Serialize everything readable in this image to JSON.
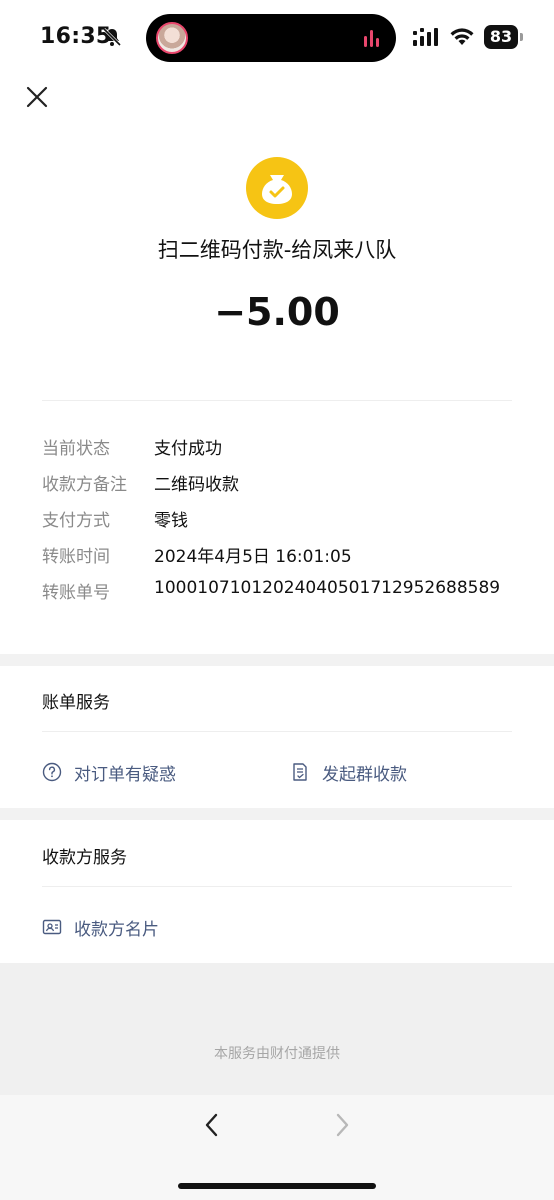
{
  "status_bar": {
    "time": "16:35",
    "battery": "83",
    "icons": [
      "bell-off-icon",
      "signal-icon",
      "wifi-icon",
      "battery-icon"
    ]
  },
  "header": {
    "close_icon": "close-icon",
    "coin_icon": "money-bag-icon",
    "title": "扫二维码付款-给凤来八队",
    "amount": "−5.00",
    "coin_color": "#f6c414"
  },
  "details": [
    {
      "label": "当前状态",
      "value": "支付成功"
    },
    {
      "label": "收款方备注",
      "value": "二维码收款"
    },
    {
      "label": "支付方式",
      "value": "零钱"
    },
    {
      "label": "转账时间",
      "value": "2024年4月5日 16:01:05"
    },
    {
      "label": "转账单号",
      "value": "100010710120240405017129526885​89"
    }
  ],
  "bill_services": {
    "title": "账单服务",
    "actions": [
      {
        "label": "对订单有疑惑",
        "icon": "question-circle-icon"
      },
      {
        "label": "发起群收款",
        "icon": "document-check-icon"
      }
    ]
  },
  "payee_services": {
    "title": "收款方服务",
    "actions": [
      {
        "label": "收款方名片",
        "icon": "contact-card-icon"
      }
    ]
  },
  "footer": {
    "text": "本服务由财付通提供"
  },
  "nav": {
    "back_icon": "chevron-left-icon",
    "forward_icon": "chevron-right-icon"
  },
  "colors": {
    "link": "#4a5b80",
    "label_gray": "#8a8a8a",
    "accent_yellow": "#f6c414"
  }
}
